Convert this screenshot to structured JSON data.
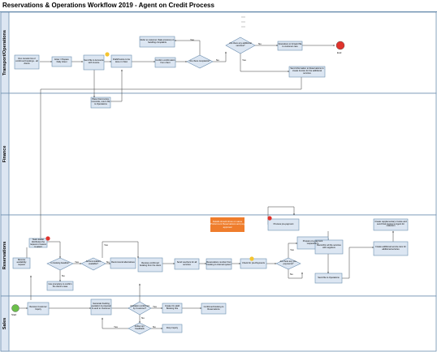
{
  "title": "Reservations & Operations Workflow 2019 - Agent on Credit Process",
  "lanes": [
    "Transport/Operations",
    "Finance",
    "Reservations",
    "Sales"
  ],
  "colors": {
    "lane_header": "#dce6f2",
    "box_fill": "#dce6f2",
    "box_stroke": "#6d8fb0",
    "line": "#3c3c3c",
    "end": "#e0332c",
    "start": "#6bbf4a",
    "highlight": "#ef7d2c",
    "warning": "#e0332c",
    "check": "#f4c430"
  },
  "nodes": {
    "t1": "Run transfer list of confirmed bookings - all clients",
    "t2": "Enter / Prepare Daily sheet",
    "t3": "Send file to Accounts with Invoice",
    "t4": "Draft/Invoice to be done in Vdoc",
    "t5": "Confirm confirmation from client",
    "t6": "Refer to customer (Sale process) on handling complaints",
    "t7": "Are there complaints?",
    "t8": "Are there any additional services?",
    "t9": "Operations to forward file to customer care",
    "t10": "End",
    "t11": "Send information to Reservations to create Invoice for the additional services",
    "t12": "Place final invoice, reconcile, return file to Operations",
    "r1": "Reservations Team leader distributes the request or leaves to agent",
    "r2": "Receive availability request",
    "r3": "Is booking feasible?",
    "r4": "Use procedure to confirm the client's case",
    "r5": "Accommodation available?",
    "r6": "Recommend alternatives",
    "r7": "Receive confirmed booking from the client",
    "r8": "Send vouchers for all services",
    "r9": "Reservations number from booking to internal system",
    "r10": "Check for pre-Payments",
    "r11": "Are there any pre-payments?",
    "r12": "Process pre-payment",
    "r13": "Prepare pre-payment request/form",
    "r14": "Reconfirm all the services with suppliers",
    "r15": "Send file to Operations",
    "f1": "Create supplementary invoice and send final invoice to Agent for collection",
    "f2": "Create additional service item for additional services",
    "s1": "Receive Customer Inquiry",
    "s2": "Generate booking quotation & proposal & send to Customer",
    "s3": "Quotation confirmed by Customer?",
    "s4": "Create On-Hold Booking File",
    "s5": "Confirmed booking to Reservations",
    "s6": "Follow up / Feedback",
    "s7": "Drop Inquiry",
    "start": "Start",
    "end": "End"
  },
  "edge_labels": {
    "yes": "Yes",
    "no": "No"
  },
  "highlight_note": "Details should show on same Proforma & Reservations and pay approval"
}
